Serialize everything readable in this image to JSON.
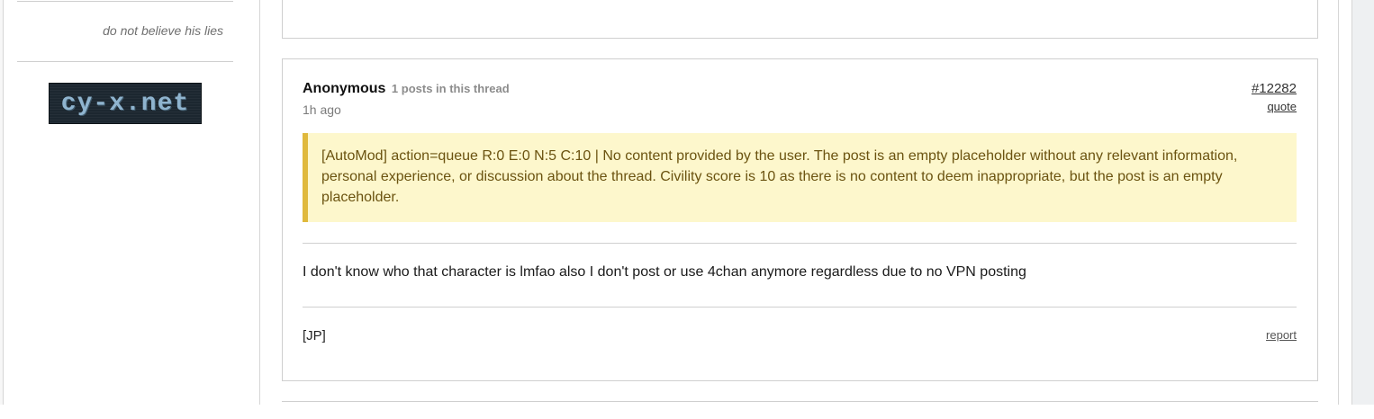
{
  "sidebar": {
    "tagline": "do not believe his lies",
    "banner_text": "cy-x.net"
  },
  "post": {
    "author": "Anonymous",
    "post_count": "1 posts in this thread",
    "time": "1h ago",
    "id": "#12282",
    "quote_label": "quote",
    "automod_text": "[AutoMod] action=queue R:0 E:0 N:5 C:10 | No content provided by the user. The post is an empty placeholder without any relevant information, personal experience, or discussion about the thread. Civility score is 10 as there is no content to deem inappropriate, but the post is an empty placeholder.",
    "body": "I don't know who that character is lmfao also I don't post or use 4chan anymore regardless due to no VPN posting",
    "flag": "[JP]",
    "report_label": "report"
  },
  "colors": {
    "automod_bg": "#fdf7cc",
    "automod_border": "#e0b93c",
    "automod_text": "#6b5310"
  }
}
